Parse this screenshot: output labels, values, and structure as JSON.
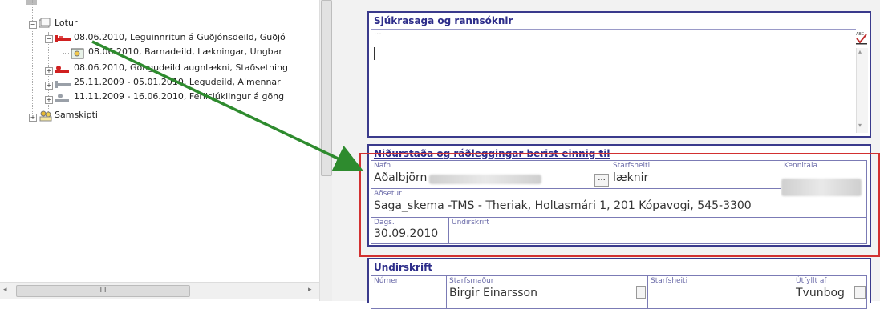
{
  "tree": {
    "items": [
      {
        "label": "Lotur"
      },
      {
        "label": "08.06.2010, Leguinnritun á Guðjónsdeild, Guðjó"
      },
      {
        "label": "08.06.2010, Barnadeild, Lækningar, Ungbar"
      },
      {
        "label": "08.06.2010, Göngudeild augnlækni, Staðsetning"
      },
      {
        "label": "25.11.2009 - 05.01.2010, Legudeild, Almennar"
      },
      {
        "label": "11.11.2009 - 16.06.2010, Ferlisjúklingur á göng"
      },
      {
        "label": "Samskipti"
      }
    ],
    "hscroll_thumb": "III"
  },
  "form": {
    "history": {
      "title": "Sjúkrasaga og rannsóknir",
      "placeholder": "..."
    },
    "results": {
      "title": "Niðurstaða og ráðleggingar berist einnig til",
      "name_label": "Nafn",
      "name_value": "Aðalbjörn",
      "lookup_button": "...",
      "profession_label": "Starfsheiti",
      "profession_value": "læknir",
      "ssn_label": "Kennitala",
      "address_label": "Aðsetur",
      "address_value": "Saga_skema -TMS - Theriak, Holtasmári 1, 201 Kópavogi, 545-3300",
      "date_label": "Dags.",
      "date_value": "30.09.2010",
      "signature_label": "Undirskrift"
    },
    "signature": {
      "title": "Undirskrift",
      "number_label": "Númer",
      "staff_label": "Starfsmaður",
      "staff_value": "Birgir Einarsson",
      "profession_label": "Starfsheiti",
      "filled_by_label": "Útfyllt af",
      "filled_by_value": "Tvunbog"
    }
  },
  "colors": {
    "section_border": "#3a3a8c",
    "title_text": "#2d2d8a",
    "highlight_box": "#d23030",
    "arrow": "#2e8b2e"
  }
}
